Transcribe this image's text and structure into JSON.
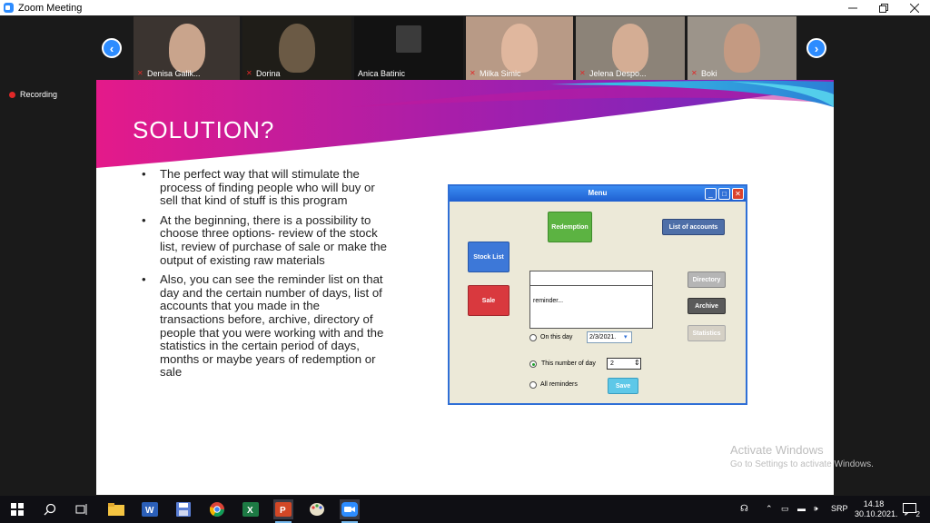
{
  "window": {
    "title": "Zoom Meeting"
  },
  "participants": [
    {
      "name": "Denisa Galik..."
    },
    {
      "name": "Dorina"
    },
    {
      "name": "Anica Batinic"
    },
    {
      "name": "Milka Simic"
    },
    {
      "name": "Jelena Despo..."
    },
    {
      "name": "Boki"
    }
  ],
  "recording": {
    "label": "Recording"
  },
  "slide": {
    "title": "SOLUTION?",
    "bullets": [
      "The perfect way that will stimulate the process of finding people who will buy or sell that kind of stuff is this program",
      "At the beginning, there is a possibility to choose three options- review of the stock list, review of purchase of sale or make the output of existing raw materials",
      "Also, you can see the  reminder list on that day and the certain number of days, list of accounts that you made in the transactions before, archive, directory of people that you were working with and the statistics in the certain period of days, months or maybe years of redemption or sale"
    ]
  },
  "mockup": {
    "title": "Menu",
    "redemption": "Redemption",
    "list_of_accounts": "List of accounts",
    "stock_list": "Stock List",
    "sale": "Sale",
    "reminder_text": "reminder...",
    "directory": "Directory",
    "archive": "Archive",
    "statistics": "Statistics",
    "on_this_day": "On this day",
    "date_value": "2/3/2021.",
    "this_number_of_day": "This number of day",
    "number_value": "2",
    "all_reminders": "All reminders",
    "save": "Save",
    "selected_option": "This number of day"
  },
  "watermark": {
    "line1": "Activate Windows",
    "line2": "Go to Settings to activate Windows."
  },
  "taskbar": {
    "language": "SRP",
    "time": "14.18",
    "date": "30.10.2021.",
    "notifications": "2"
  },
  "colors": {
    "zoom_blue": "#2d8cff",
    "muted_red": "#e02828",
    "redemption_green": "#5cb342",
    "stock_blue": "#3d78d8",
    "sale_red": "#d9393e",
    "save_cyan": "#5ec8e8"
  }
}
